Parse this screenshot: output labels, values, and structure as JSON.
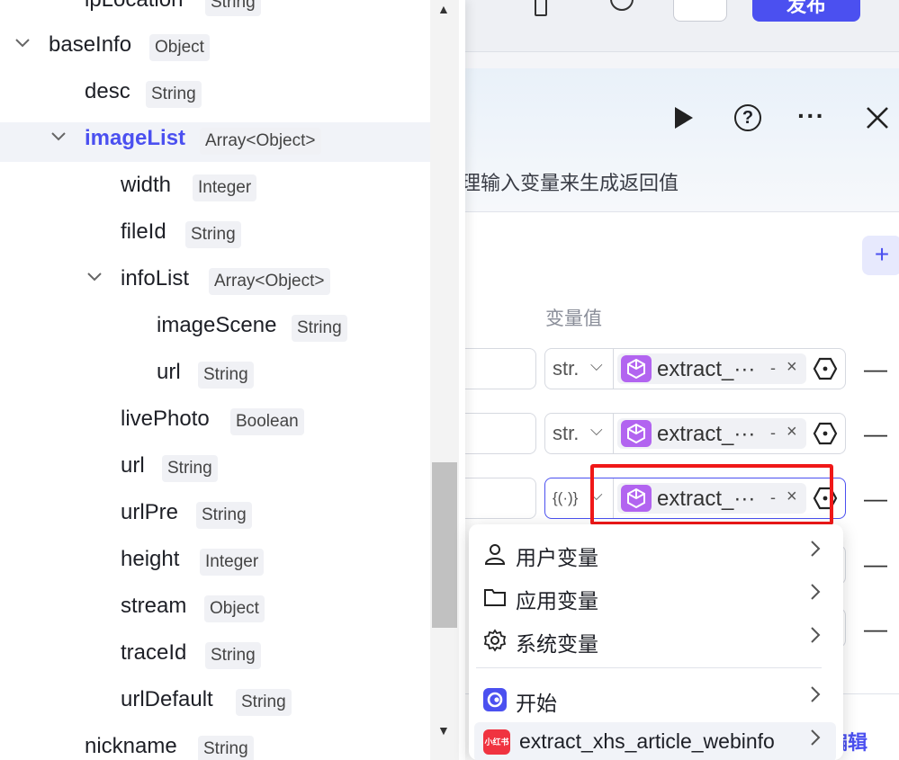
{
  "topbar": {
    "publish_label": "发布"
  },
  "panel": {
    "description": "理输入变量来生成返回值",
    "column_label": "变量值",
    "plus_label": "+",
    "bottom_action": "编辑"
  },
  "variable_rows": [
    {
      "type": "str.",
      "tag": "extract_···",
      "dash": "-",
      "close": "×",
      "minus": "—"
    },
    {
      "type": "str.",
      "tag": "extract_···",
      "dash": "-",
      "close": "×",
      "minus": "—"
    },
    {
      "type": "{(·)}",
      "tag": "extract_···",
      "dash": "-",
      "close": "×",
      "minus": "—"
    }
  ],
  "extra_minus": [
    "—",
    "—"
  ],
  "tree": {
    "items": [
      {
        "name": "ipLocation",
        "type": "String"
      },
      {
        "name": "baseInfo",
        "type": "Object"
      },
      {
        "name": "desc",
        "type": "String"
      },
      {
        "name": "imageList",
        "type": "Array<Object>"
      },
      {
        "name": "width",
        "type": "Integer"
      },
      {
        "name": "fileId",
        "type": "String"
      },
      {
        "name": "infoList",
        "type": "Array<Object>"
      },
      {
        "name": "imageScene",
        "type": "String"
      },
      {
        "name": "url",
        "type": "String"
      },
      {
        "name": "livePhoto",
        "type": "Boolean"
      },
      {
        "name": "url",
        "type": "String"
      },
      {
        "name": "urlPre",
        "type": "String"
      },
      {
        "name": "height",
        "type": "Integer"
      },
      {
        "name": "stream",
        "type": "Object"
      },
      {
        "name": "traceId",
        "type": "String"
      },
      {
        "name": "urlDefault",
        "type": "String"
      },
      {
        "name": "nickname",
        "type": "String"
      }
    ]
  },
  "menu": {
    "items": [
      {
        "label": "用户变量",
        "icon": "user-icon"
      },
      {
        "label": "应用变量",
        "icon": "folder-icon"
      },
      {
        "label": "系统变量",
        "icon": "gear-icon"
      },
      {
        "label": "开始",
        "icon": "start-icon"
      },
      {
        "label": "extract_xhs_article_webinfo",
        "icon": "xiaohongshu-icon",
        "icon_text": "小红书"
      }
    ]
  }
}
